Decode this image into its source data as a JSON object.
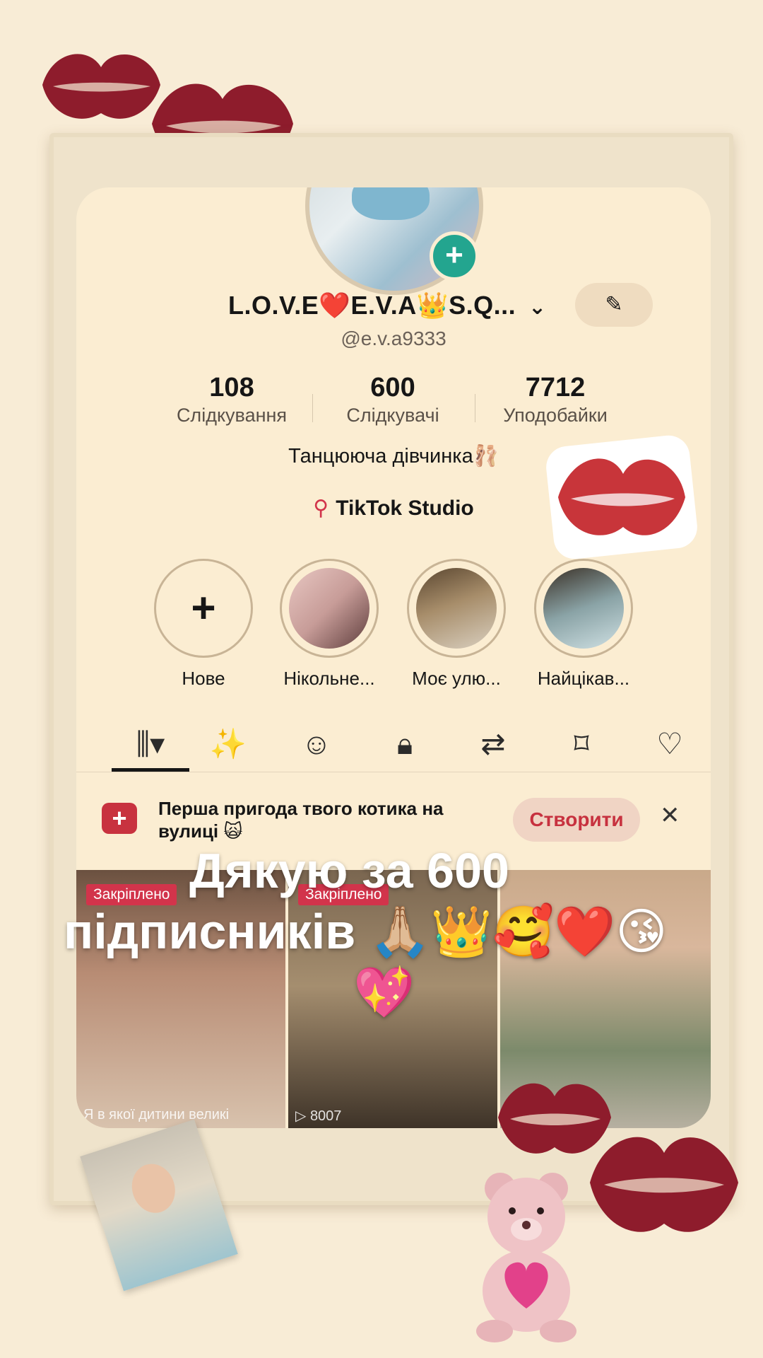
{
  "profile": {
    "display_name": "L.O.V.E❤️E.V.A👑S.Q...",
    "handle": "@e.v.a9333",
    "bio": "Танцююча дівчинка🩰",
    "studio_link": "TikTok Studio"
  },
  "stats": [
    {
      "value": "108",
      "label": "Слідкування"
    },
    {
      "value": "600",
      "label": "Слідкувачі"
    },
    {
      "value": "7712",
      "label": "Уподобайки"
    }
  ],
  "highlights": [
    {
      "label": "Нове"
    },
    {
      "label": "Нікольне..."
    },
    {
      "label": "Моє улю..."
    },
    {
      "label": "Найцікав..."
    }
  ],
  "tabs": [
    "videos-tab",
    "reposts-magic-tab",
    "stickers-tab",
    "private-tab",
    "reposts-tab",
    "favorites-tab",
    "liked-tab"
  ],
  "promo": {
    "text": "Перша пригода твого котика на вулиці 🙀",
    "button": "Створити"
  },
  "grid": [
    {
      "pinned": "Закріплено",
      "caption": "Я в якої дитини великі"
    },
    {
      "pinned": "Закріплено",
      "caption": "▷ 8007"
    },
    {
      "pinned": "",
      "caption": ""
    }
  ],
  "overlay": {
    "line1": "Дякую за 600",
    "line2": "підписників 🙏🏼👑🥰❤️😘",
    "line3": "💖"
  },
  "colors": {
    "background": "#f8ecd6",
    "screen": "#fbedd2",
    "accent_red": "#d2344b",
    "follow_badge": "#23a58f"
  }
}
